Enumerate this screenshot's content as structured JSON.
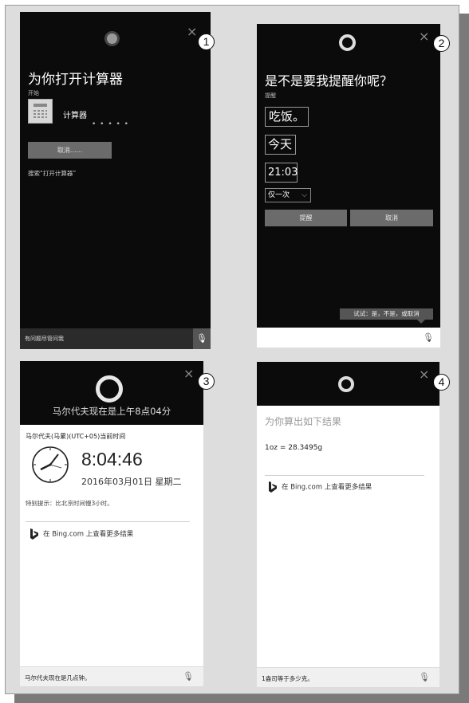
{
  "panel1": {
    "close_icon": "close-icon",
    "title": "为你打开计算器",
    "section_label": "开始",
    "app_name": "计算器",
    "loading_dots": "• • • • •",
    "cancel_label": "取消......",
    "search_link": "搜索“打开计算器”",
    "input_placeholder": "有问题尽管问我",
    "mic_icon": "microphone-icon"
  },
  "panel2": {
    "title": "是不是要我提醒你呢？",
    "section_label": "提醒",
    "reminder_text": "吃饭。",
    "reminder_day": "今天",
    "reminder_time": "21:03",
    "repeat_value": "仅一次",
    "remind_label": "提醒",
    "cancel_label": "取消",
    "hint": "试试：是，不是，或取消",
    "mic_icon": "microphone-icon"
  },
  "panel3": {
    "header_text": "马尔代夫现在是上午8点04分",
    "location_line": "马尔代夫(马累)(UTC+05)当前时间",
    "time": "8:04:46",
    "date": "2016年03月01日 星期二",
    "note": "特别提示：比北京时间慢3小时。",
    "bing_link": "在 Bing.com 上查看更多结果",
    "query": "马尔代夫现在是几点钟。",
    "mic_icon": "microphone-icon"
  },
  "panel4": {
    "title": "为你算出如下结果",
    "result": "1oz = 28.3495g",
    "bing_link": "在 Bing.com 上查看更多结果",
    "query": "1盎司等于多少克。",
    "mic_icon": "microphone-icon"
  },
  "badges": [
    "1",
    "2",
    "3",
    "4"
  ],
  "colors": {
    "dark_bg": "#0b0b0b",
    "button_gray": "#6b6b6b",
    "frame_bg": "#dddddd"
  }
}
